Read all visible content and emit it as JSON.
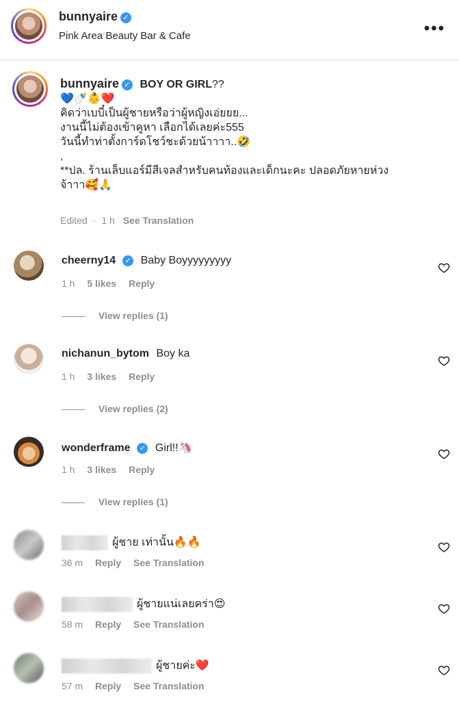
{
  "post": {
    "username": "bunnyaire",
    "location": "Pink Area Beauty Bar & Cafe",
    "more_label": "•••"
  },
  "caption": {
    "username": "bunnyaire",
    "title": "BOY OR GIRL",
    "title_suffix": "??",
    "lines": [
      "💙🍼👶❤️",
      "คิดว่าเบบี๋เป็นผู้ชายหรือว่าผู้หญิงเอ่ยยย...",
      "งานนี้ไม่ต้องเข้าคูหา เลือกได้เลยค่ะ555",
      "วันนี้ทำท่าตั้งการ์ดโชว์ชะด้วยน้าาาา..🤣",
      ",",
      "**ปล. ร้านเล็บแอร์มีสีเจลสำหรับคนท้องและเด็กนะคะ ปลอดภัยหายห่วง",
      "จ้าาา🥰🙏"
    ],
    "edited": "Edited",
    "time": "1 h",
    "see_translation": "See Translation"
  },
  "comments": [
    {
      "username": "cheerny14",
      "verified": true,
      "text": "Baby Boyyyyyyyyy",
      "time": "1 h",
      "likes": "5 likes",
      "reply": "Reply",
      "view_replies": "View replies (1)"
    },
    {
      "username": "nichanun_bytom",
      "verified": false,
      "text": "Boy ka",
      "time": "1 h",
      "likes": "3 likes",
      "reply": "Reply",
      "view_replies": "View replies (2)"
    },
    {
      "username": "wonderframe",
      "verified": true,
      "text": "Girl!!🦄",
      "time": "1 h",
      "likes": "3 likes",
      "reply": "Reply",
      "view_replies": "View replies (1)"
    },
    {
      "text": "ผู้ชาย เท่านั้น🔥🔥",
      "time": "36 m",
      "reply": "Reply",
      "see_translation": "See Translation"
    },
    {
      "text": "ผู้ชายแน่เลยคร่า😍",
      "time": "58 m",
      "reply": "Reply",
      "see_translation": "See Translation"
    },
    {
      "text": "ผู้ชายค่ะ❤️",
      "time": "57 m",
      "reply": "Reply",
      "see_translation": "See Translation"
    }
  ],
  "colors": {
    "verified": "#3897f0",
    "muted": "#8e8e8e",
    "text": "#262626"
  }
}
